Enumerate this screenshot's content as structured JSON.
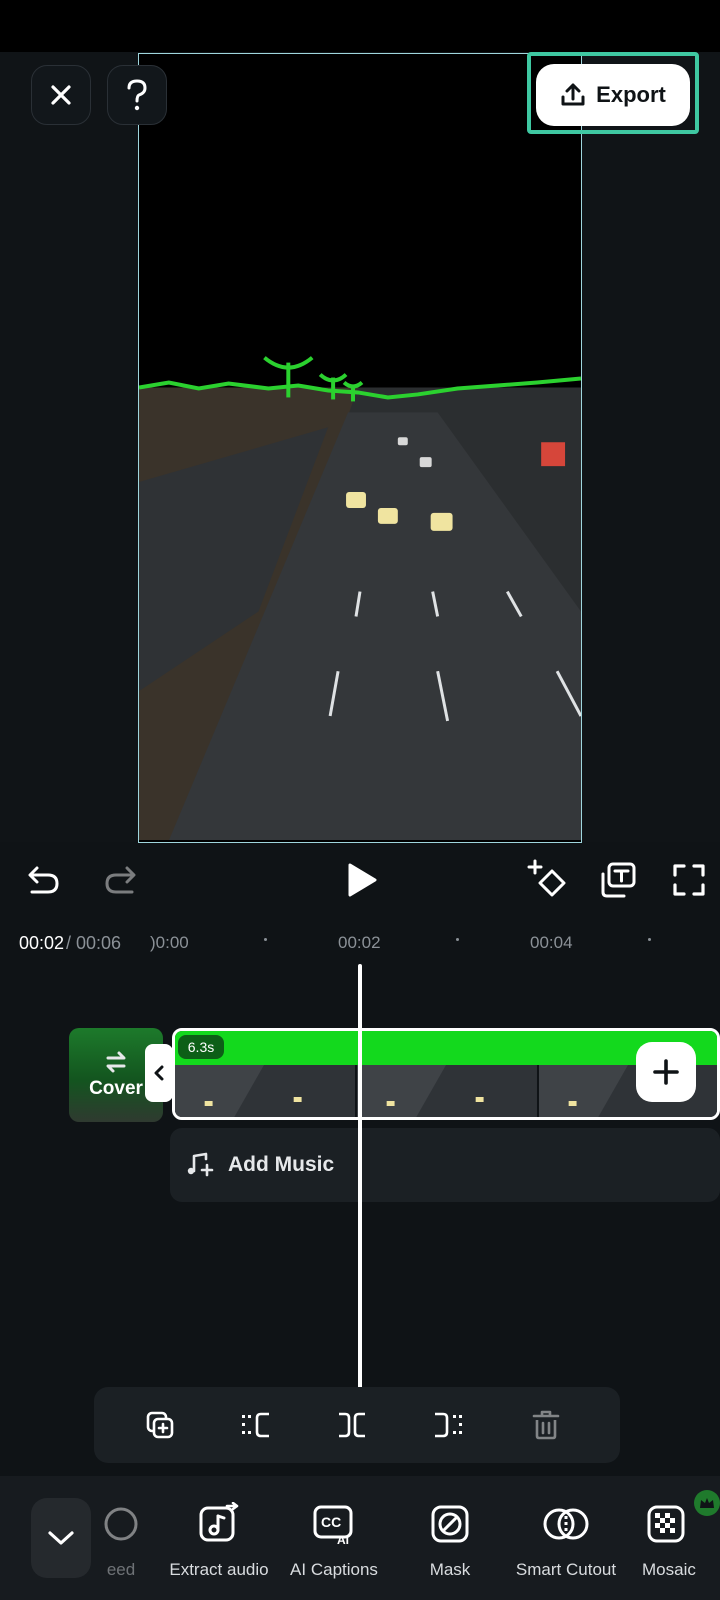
{
  "top": {
    "export_label": "Export",
    "close_icon": "close-icon",
    "help_icon": "help-icon"
  },
  "playback": {
    "current_time": "00:02",
    "total_time": " / 00:06"
  },
  "ruler": {
    "ticks": [
      ")0:00",
      "00:02",
      "00:04"
    ]
  },
  "timeline": {
    "cover_label": "Cover",
    "clip_duration": "6.3s",
    "add_music_label": "Add Music"
  },
  "toolbar": {
    "items": [
      {
        "label": "eed"
      },
      {
        "label": "Extract audio"
      },
      {
        "label": "AI Captions"
      },
      {
        "label": "Mask"
      },
      {
        "label": "Smart Cutout"
      },
      {
        "label": "Mosaic"
      }
    ]
  },
  "colors": {
    "accent_highlight": "#3fc8a2",
    "chroma_green": "#13d91d",
    "background": "#0f1316"
  }
}
